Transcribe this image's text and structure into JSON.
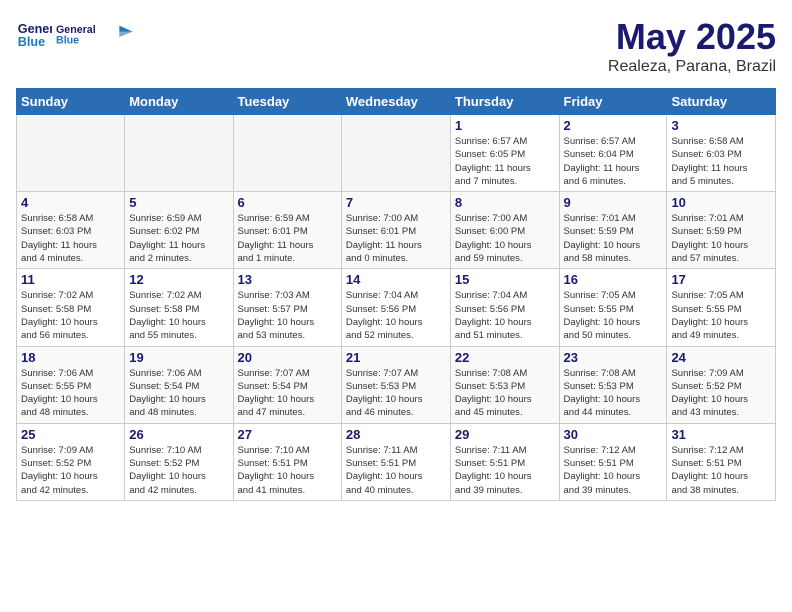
{
  "header": {
    "logo_line1": "General",
    "logo_line2": "Blue",
    "month": "May 2025",
    "location": "Realeza, Parana, Brazil"
  },
  "weekdays": [
    "Sunday",
    "Monday",
    "Tuesday",
    "Wednesday",
    "Thursday",
    "Friday",
    "Saturday"
  ],
  "weeks": [
    [
      {
        "day": "",
        "info": ""
      },
      {
        "day": "",
        "info": ""
      },
      {
        "day": "",
        "info": ""
      },
      {
        "day": "",
        "info": ""
      },
      {
        "day": "1",
        "info": "Sunrise: 6:57 AM\nSunset: 6:05 PM\nDaylight: 11 hours\nand 7 minutes."
      },
      {
        "day": "2",
        "info": "Sunrise: 6:57 AM\nSunset: 6:04 PM\nDaylight: 11 hours\nand 6 minutes."
      },
      {
        "day": "3",
        "info": "Sunrise: 6:58 AM\nSunset: 6:03 PM\nDaylight: 11 hours\nand 5 minutes."
      }
    ],
    [
      {
        "day": "4",
        "info": "Sunrise: 6:58 AM\nSunset: 6:03 PM\nDaylight: 11 hours\nand 4 minutes."
      },
      {
        "day": "5",
        "info": "Sunrise: 6:59 AM\nSunset: 6:02 PM\nDaylight: 11 hours\nand 2 minutes."
      },
      {
        "day": "6",
        "info": "Sunrise: 6:59 AM\nSunset: 6:01 PM\nDaylight: 11 hours\nand 1 minute."
      },
      {
        "day": "7",
        "info": "Sunrise: 7:00 AM\nSunset: 6:01 PM\nDaylight: 11 hours\nand 0 minutes."
      },
      {
        "day": "8",
        "info": "Sunrise: 7:00 AM\nSunset: 6:00 PM\nDaylight: 10 hours\nand 59 minutes."
      },
      {
        "day": "9",
        "info": "Sunrise: 7:01 AM\nSunset: 5:59 PM\nDaylight: 10 hours\nand 58 minutes."
      },
      {
        "day": "10",
        "info": "Sunrise: 7:01 AM\nSunset: 5:59 PM\nDaylight: 10 hours\nand 57 minutes."
      }
    ],
    [
      {
        "day": "11",
        "info": "Sunrise: 7:02 AM\nSunset: 5:58 PM\nDaylight: 10 hours\nand 56 minutes."
      },
      {
        "day": "12",
        "info": "Sunrise: 7:02 AM\nSunset: 5:58 PM\nDaylight: 10 hours\nand 55 minutes."
      },
      {
        "day": "13",
        "info": "Sunrise: 7:03 AM\nSunset: 5:57 PM\nDaylight: 10 hours\nand 53 minutes."
      },
      {
        "day": "14",
        "info": "Sunrise: 7:04 AM\nSunset: 5:56 PM\nDaylight: 10 hours\nand 52 minutes."
      },
      {
        "day": "15",
        "info": "Sunrise: 7:04 AM\nSunset: 5:56 PM\nDaylight: 10 hours\nand 51 minutes."
      },
      {
        "day": "16",
        "info": "Sunrise: 7:05 AM\nSunset: 5:55 PM\nDaylight: 10 hours\nand 50 minutes."
      },
      {
        "day": "17",
        "info": "Sunrise: 7:05 AM\nSunset: 5:55 PM\nDaylight: 10 hours\nand 49 minutes."
      }
    ],
    [
      {
        "day": "18",
        "info": "Sunrise: 7:06 AM\nSunset: 5:55 PM\nDaylight: 10 hours\nand 48 minutes."
      },
      {
        "day": "19",
        "info": "Sunrise: 7:06 AM\nSunset: 5:54 PM\nDaylight: 10 hours\nand 48 minutes."
      },
      {
        "day": "20",
        "info": "Sunrise: 7:07 AM\nSunset: 5:54 PM\nDaylight: 10 hours\nand 47 minutes."
      },
      {
        "day": "21",
        "info": "Sunrise: 7:07 AM\nSunset: 5:53 PM\nDaylight: 10 hours\nand 46 minutes."
      },
      {
        "day": "22",
        "info": "Sunrise: 7:08 AM\nSunset: 5:53 PM\nDaylight: 10 hours\nand 45 minutes."
      },
      {
        "day": "23",
        "info": "Sunrise: 7:08 AM\nSunset: 5:53 PM\nDaylight: 10 hours\nand 44 minutes."
      },
      {
        "day": "24",
        "info": "Sunrise: 7:09 AM\nSunset: 5:52 PM\nDaylight: 10 hours\nand 43 minutes."
      }
    ],
    [
      {
        "day": "25",
        "info": "Sunrise: 7:09 AM\nSunset: 5:52 PM\nDaylight: 10 hours\nand 42 minutes."
      },
      {
        "day": "26",
        "info": "Sunrise: 7:10 AM\nSunset: 5:52 PM\nDaylight: 10 hours\nand 42 minutes."
      },
      {
        "day": "27",
        "info": "Sunrise: 7:10 AM\nSunset: 5:51 PM\nDaylight: 10 hours\nand 41 minutes."
      },
      {
        "day": "28",
        "info": "Sunrise: 7:11 AM\nSunset: 5:51 PM\nDaylight: 10 hours\nand 40 minutes."
      },
      {
        "day": "29",
        "info": "Sunrise: 7:11 AM\nSunset: 5:51 PM\nDaylight: 10 hours\nand 39 minutes."
      },
      {
        "day": "30",
        "info": "Sunrise: 7:12 AM\nSunset: 5:51 PM\nDaylight: 10 hours\nand 39 minutes."
      },
      {
        "day": "31",
        "info": "Sunrise: 7:12 AM\nSunset: 5:51 PM\nDaylight: 10 hours\nand 38 minutes."
      }
    ]
  ]
}
